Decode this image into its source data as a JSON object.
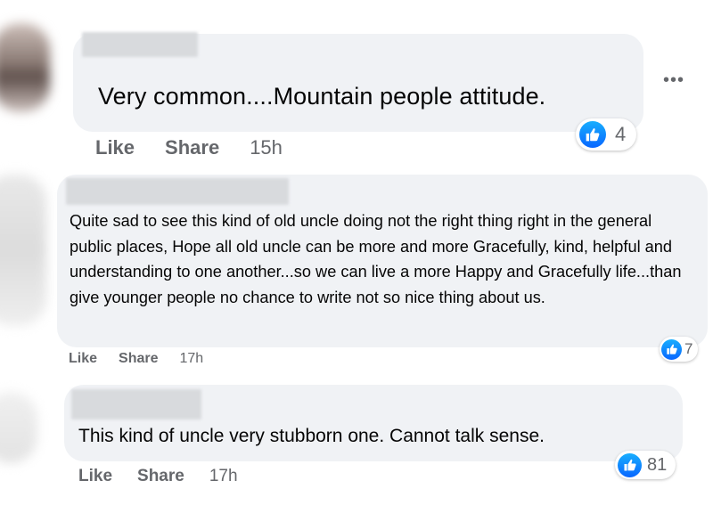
{
  "comments": [
    {
      "text": "Very common....Mountain people attitude.",
      "actions": {
        "like": "Like",
        "share": "Share",
        "time": "15h"
      },
      "reaction_count": "4"
    },
    {
      "text": "Quite sad to see this kind of old uncle doing not the right thing right in the general public places, Hope all old uncle can be more and more Gracefully, kind, helpful and understanding to one another...so we can live a more Happy and Gracefully life...than give younger people no chance to write not so nice thing about us.",
      "actions": {
        "like": "Like",
        "share": "Share",
        "time": "17h"
      },
      "reaction_count": "7"
    },
    {
      "text": "This kind of uncle very stubborn one. Cannot talk sense.",
      "actions": {
        "like": "Like",
        "share": "Share",
        "time": "17h"
      },
      "reaction_count": "81"
    }
  ],
  "more_options_label": "•••",
  "icons": {
    "reaction": "like-thumbs-up-icon",
    "menu": "more-options-icon"
  },
  "colors": {
    "bubble": "#f0f2f5",
    "meta_text": "#65676b",
    "like_blue": "#0866ff"
  }
}
